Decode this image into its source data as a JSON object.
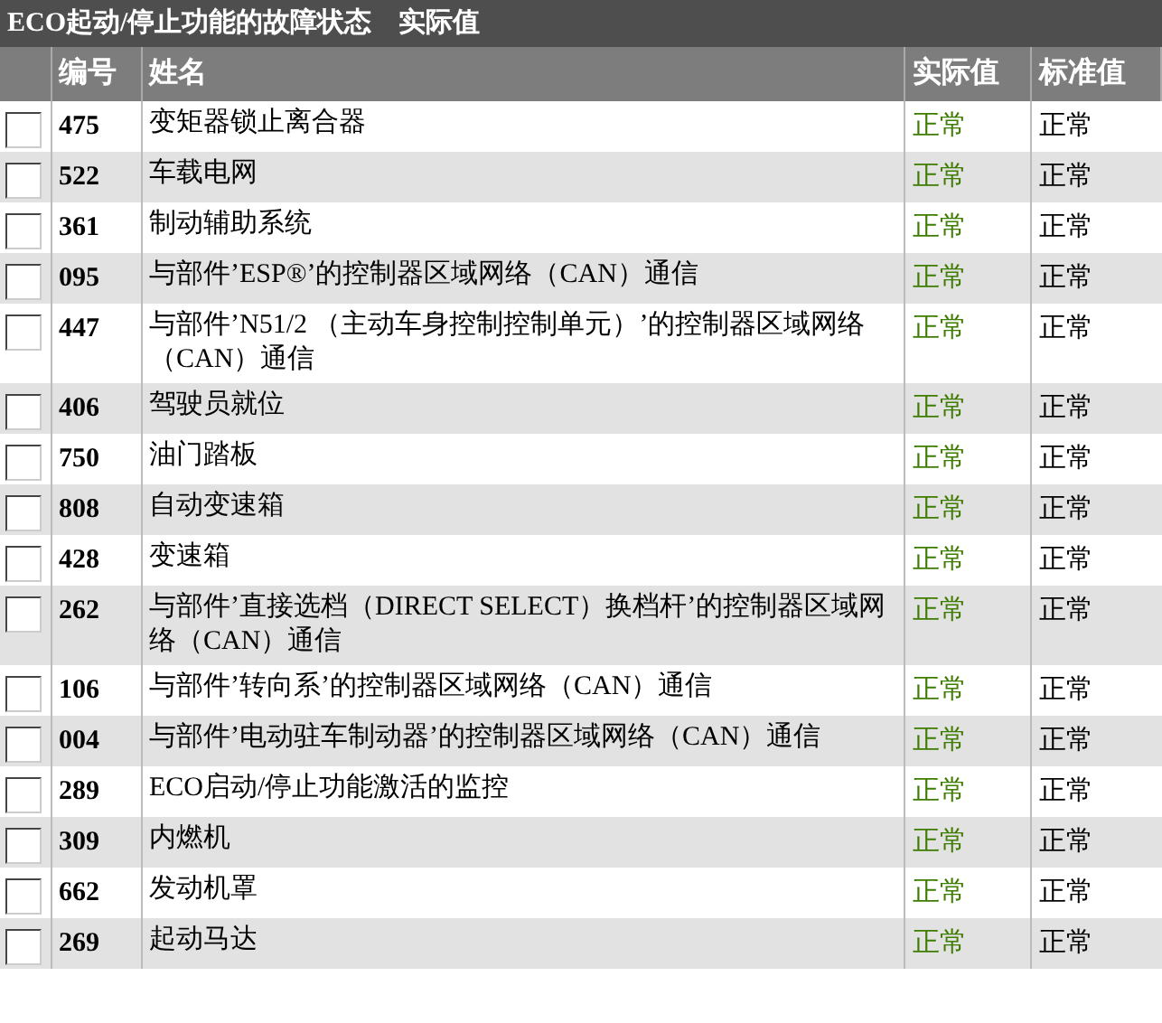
{
  "title": "ECO起动/停止功能的故障状态　实际值",
  "columns": [
    "编号",
    "姓名",
    "实际值",
    "标准值"
  ],
  "rows": [
    {
      "checked": false,
      "number": "475",
      "name": "变矩器锁止离合器",
      "actual": "正常",
      "standard": "正常"
    },
    {
      "checked": false,
      "number": "522",
      "name": "车载电网",
      "actual": "正常",
      "standard": "正常"
    },
    {
      "checked": false,
      "number": "361",
      "name": "制动辅助系统",
      "actual": "正常",
      "standard": "正常"
    },
    {
      "checked": false,
      "number": "095",
      "name": "与部件’ESP®’的控制器区域网络（CAN）通信",
      "actual": "正常",
      "standard": "正常"
    },
    {
      "checked": false,
      "number": "447",
      "name": "与部件’N51/2 （主动车身控制控制单元）’的控制器区域网络（CAN）通信",
      "actual": "正常",
      "standard": "正常"
    },
    {
      "checked": false,
      "number": "406",
      "name": "驾驶员就位",
      "actual": "正常",
      "standard": "正常"
    },
    {
      "checked": false,
      "number": "750",
      "name": "油门踏板",
      "actual": "正常",
      "standard": "正常"
    },
    {
      "checked": false,
      "number": "808",
      "name": "自动变速箱",
      "actual": "正常",
      "standard": "正常"
    },
    {
      "checked": false,
      "number": "428",
      "name": "变速箱",
      "actual": "正常",
      "standard": "正常"
    },
    {
      "checked": false,
      "number": "262",
      "name": "与部件’直接选档（DIRECT SELECT）换档杆’的控制器区域网络（CAN）通信",
      "actual": "正常",
      "standard": "正常"
    },
    {
      "checked": false,
      "number": "106",
      "name": "与部件’转向系’的控制器区域网络（CAN）通信",
      "actual": "正常",
      "standard": "正常"
    },
    {
      "checked": false,
      "number": "004",
      "name": "与部件’电动驻车制动器’的控制器区域网络（CAN）通信",
      "actual": "正常",
      "standard": "正常"
    },
    {
      "checked": false,
      "number": "289",
      "name": "ECO启动/停止功能激活的监控",
      "actual": "正常",
      "standard": "正常"
    },
    {
      "checked": false,
      "number": "309",
      "name": "内燃机",
      "actual": "正常",
      "standard": "正常"
    },
    {
      "checked": false,
      "number": "662",
      "name": "发动机罩",
      "actual": "正常",
      "standard": "正常"
    },
    {
      "checked": false,
      "number": "269",
      "name": "起动马达",
      "actual": "正常",
      "standard": "正常"
    }
  ]
}
